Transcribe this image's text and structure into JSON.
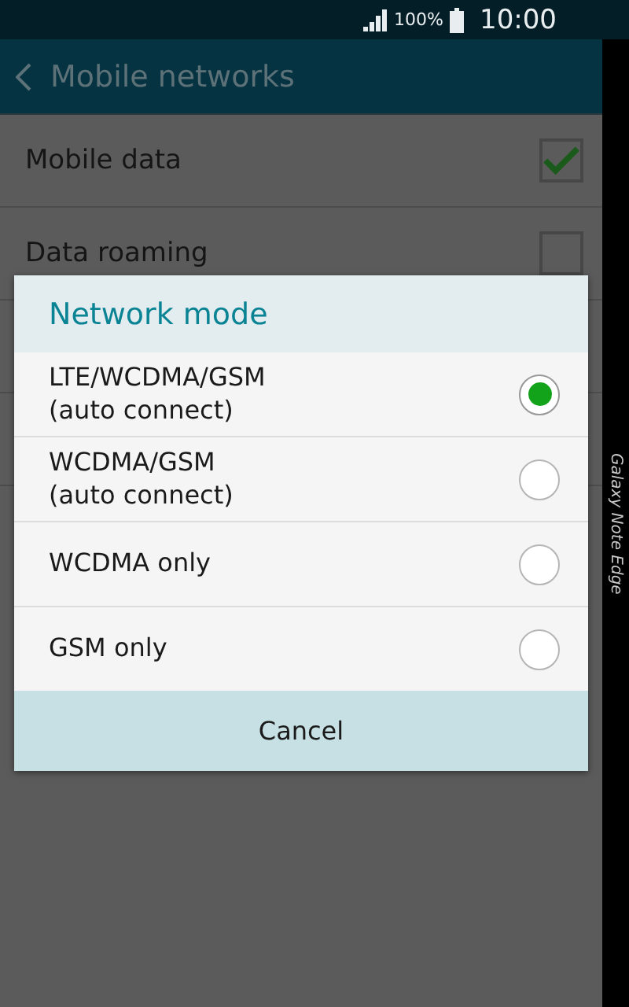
{
  "status_bar": {
    "battery": "100%",
    "time": "10:00"
  },
  "app_bar": {
    "title": "Mobile networks"
  },
  "settings": [
    {
      "label": "Mobile data",
      "checked": true
    },
    {
      "label": "Data roaming",
      "checked": false
    }
  ],
  "dialog": {
    "title": "Network mode",
    "options": [
      {
        "label": "LTE/WCDMA/GSM",
        "note": "(auto connect)",
        "selected": true
      },
      {
        "label": "WCDMA/GSM",
        "note": "(auto connect)",
        "selected": false
      },
      {
        "label": "WCDMA only",
        "selected": false
      },
      {
        "label": "GSM only",
        "selected": false
      }
    ],
    "cancel": "Cancel"
  },
  "edge_label": "Galaxy Note Edge"
}
